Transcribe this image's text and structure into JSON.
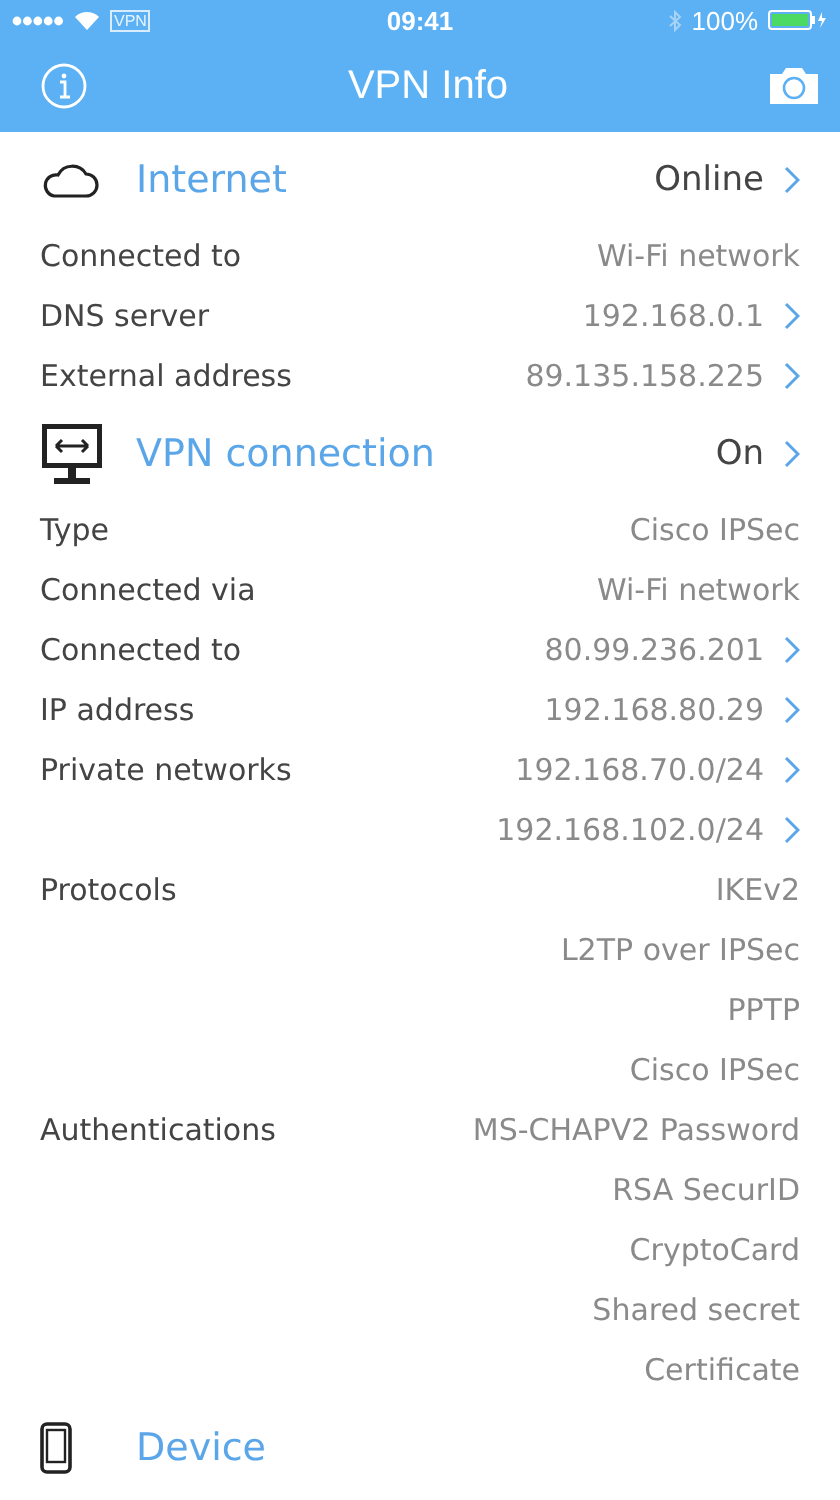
{
  "status_bar": {
    "carrier_badge": "VPN",
    "time": "09:41",
    "battery": "100%"
  },
  "nav": {
    "title": "VPN Info"
  },
  "sections": [
    {
      "kind": "cloud",
      "title": "Internet",
      "status": "Online",
      "status_link": true,
      "rows": [
        {
          "label": "Connected to",
          "values": [
            {
              "text": "Wi-Fi network",
              "link": false
            }
          ]
        },
        {
          "label": "DNS server",
          "values": [
            {
              "text": "192.168.0.1",
              "link": true
            }
          ]
        },
        {
          "label": "External address",
          "values": [
            {
              "text": "89.135.158.225",
              "link": true
            }
          ]
        }
      ]
    },
    {
      "kind": "monitor",
      "title": "VPN connection",
      "status": "On",
      "status_link": true,
      "rows": [
        {
          "label": "Type",
          "values": [
            {
              "text": "Cisco IPSec",
              "link": false
            }
          ]
        },
        {
          "label": "Connected via",
          "values": [
            {
              "text": "Wi-Fi network",
              "link": false
            }
          ]
        },
        {
          "label": "Connected to",
          "values": [
            {
              "text": "80.99.236.201",
              "link": true
            }
          ]
        },
        {
          "label": "IP address",
          "values": [
            {
              "text": "192.168.80.29",
              "link": true
            }
          ]
        },
        {
          "label": "Private networks",
          "values": [
            {
              "text": "192.168.70.0/24",
              "link": true
            },
            {
              "text": "192.168.102.0/24",
              "link": true
            }
          ]
        },
        {
          "label": "Protocols",
          "values": [
            {
              "text": "IKEv2",
              "link": false
            },
            {
              "text": "L2TP over IPSec",
              "link": false
            },
            {
              "text": "PPTP",
              "link": false
            },
            {
              "text": "Cisco IPSec",
              "link": false
            }
          ]
        },
        {
          "label": "Authentications",
          "values": [
            {
              "text": "MS-CHAPV2 Password",
              "link": false
            },
            {
              "text": "RSA SecurID",
              "link": false
            },
            {
              "text": "CryptoCard",
              "link": false
            },
            {
              "text": "Shared secret",
              "link": false
            },
            {
              "text": "Certificate",
              "link": false
            }
          ]
        }
      ]
    },
    {
      "kind": "phone",
      "title": "Device"
    }
  ]
}
